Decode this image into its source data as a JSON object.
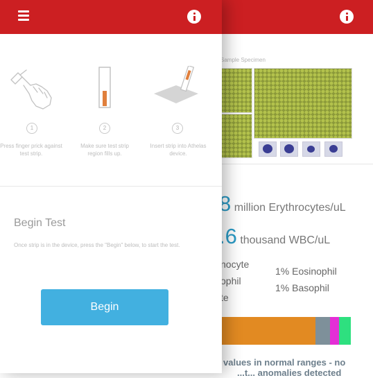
{
  "back_screen": {
    "sample_label": "Sample Specimen",
    "erythrocytes": {
      "value": "8",
      "unit": "million Erythrocytes/uL"
    },
    "wbc": {
      "value": ".6",
      "unit": "thousand WBC/uL"
    },
    "differential": [
      {
        "text": "nocyte"
      },
      {
        "text": "ophil"
      },
      {
        "text": "te"
      },
      {
        "text": "1%  Eosinophil"
      },
      {
        "text": "1%  Basophil"
      }
    ],
    "composition_bar": {
      "segments": [
        {
          "name": "segment-1",
          "fraction": 0.73,
          "color": "#e28a22"
        },
        {
          "name": "segment-2",
          "fraction": 0.11,
          "color": "#7e909a"
        },
        {
          "name": "segment-3",
          "fraction": 0.07,
          "color": "#e42fd6"
        },
        {
          "name": "segment-4",
          "fraction": 0.09,
          "color": "#2ee07f"
        }
      ]
    },
    "result_note_line1": "values in normal ranges - no",
    "result_note_line2": "...t... anomalies detected"
  },
  "front_screen": {
    "steps": [
      {
        "number": "1",
        "text": "Press finger prick against test strip."
      },
      {
        "number": "2",
        "text": "Make sure test strip region fills up."
      },
      {
        "number": "3",
        "text": "Insert strip into Athelas device."
      }
    ],
    "heading": "Begin Test",
    "instruction": "Once strip is in the device, press the \"Begin\" below, to start the test.",
    "begin_label": "Begin"
  },
  "colors": {
    "brand_red": "#cc1f22",
    "accent_blue": "#42b0e0",
    "stat_blue": "#2a9bc6"
  },
  "icons": [
    "menu-icon",
    "info-icon",
    "finger-prick-icon",
    "test-strip-icon",
    "insert-strip-icon"
  ]
}
